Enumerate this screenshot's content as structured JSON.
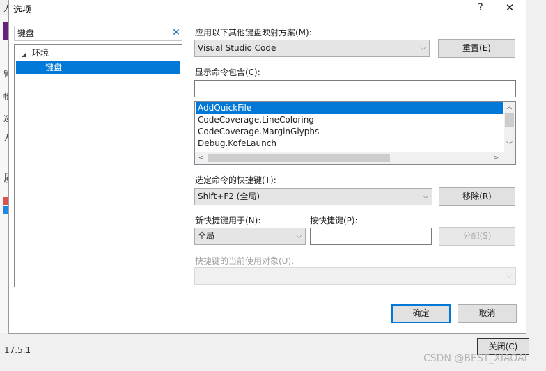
{
  "background": {
    "side_chars": [
      "人",
      "管",
      "帐",
      "选",
      "人",
      "质"
    ],
    "version": "17.5.1",
    "close_button": "关闭(C)",
    "watermark": "CSDN @BEST_XIAOAI"
  },
  "dialog": {
    "title": "选项",
    "help_glyph": "?",
    "close_glyph": "✕",
    "search": {
      "value": "键盘",
      "clear_glyph": "✕"
    },
    "tree": {
      "expand_glyph": "◢",
      "environment": "环境",
      "keyboard": "键盘"
    },
    "mapping_scheme": {
      "label": "应用以下其他键盘映射方案(M):",
      "value": "Visual Studio Code",
      "reset_button": "重置(E)"
    },
    "show_commands": {
      "label": "显示命令包含(C):",
      "value": ""
    },
    "commands": [
      {
        "text": "AddQuickFile",
        "selected": true
      },
      {
        "text": "CodeCoverage.LineColoring",
        "selected": false
      },
      {
        "text": "CodeCoverage.MarginGlyphs",
        "selected": false
      },
      {
        "text": "Debug.KofeLaunch",
        "selected": false
      }
    ],
    "shortcut_for_command": {
      "label": "选定命令的快捷键(T):",
      "value": "Shift+F2 (全局)",
      "remove_button": "移除(R)"
    },
    "use_new_shortcut_in": {
      "label": "新快捷键用于(N):",
      "value": "全局"
    },
    "press_shortcut": {
      "label": "按快捷键(P):",
      "value": "",
      "assign_button": "分配(S)"
    },
    "current_usage": {
      "label": "快捷键的当前使用对象(U):",
      "value": ""
    },
    "ok_button": "确定",
    "cancel_button": "取消"
  }
}
